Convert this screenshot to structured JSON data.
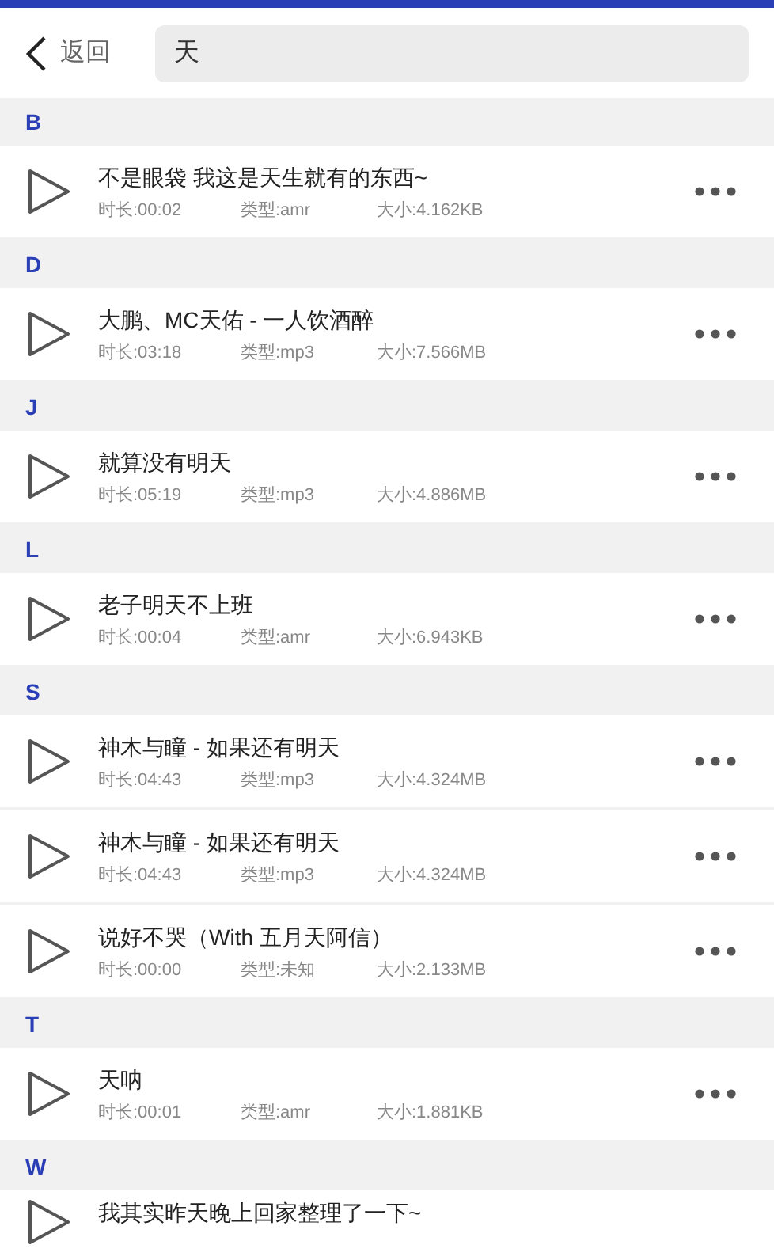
{
  "header": {
    "back_label": "返回",
    "search": {
      "value": "天"
    }
  },
  "sections": [
    {
      "letter": "B",
      "songs": [
        {
          "title": "不是眼袋 我这是天生就有的东西~",
          "duration": "时长:00:02",
          "type": "类型:amr",
          "size": "大小:4.162KB"
        }
      ]
    },
    {
      "letter": "D",
      "songs": [
        {
          "title": "大鹏、MC天佑 - 一人饮酒醉",
          "duration": "时长:03:18",
          "type": "类型:mp3",
          "size": "大小:7.566MB"
        }
      ]
    },
    {
      "letter": "J",
      "songs": [
        {
          "title": "就算没有明天",
          "duration": "时长:05:19",
          "type": "类型:mp3",
          "size": "大小:4.886MB"
        }
      ]
    },
    {
      "letter": "L",
      "songs": [
        {
          "title": "老子明天不上班",
          "duration": "时长:00:04",
          "type": "类型:amr",
          "size": "大小:6.943KB"
        }
      ]
    },
    {
      "letter": "S",
      "songs": [
        {
          "title": "神木与瞳 - 如果还有明天",
          "duration": "时长:04:43",
          "type": "类型:mp3",
          "size": "大小:4.324MB"
        },
        {
          "title": "神木与瞳 - 如果还有明天",
          "duration": "时长:04:43",
          "type": "类型:mp3",
          "size": "大小:4.324MB"
        },
        {
          "title": "说好不哭（With 五月天阿信）",
          "duration": "时长:00:00",
          "type": "类型:未知",
          "size": "大小:2.133MB"
        }
      ]
    },
    {
      "letter": "T",
      "songs": [
        {
          "title": "天呐",
          "duration": "时长:00:01",
          "type": "类型:amr",
          "size": "大小:1.881KB"
        }
      ]
    },
    {
      "letter": "W",
      "songs": [
        {
          "title": "我其实昨天晚上回家整理了一下~"
        }
      ]
    }
  ]
}
